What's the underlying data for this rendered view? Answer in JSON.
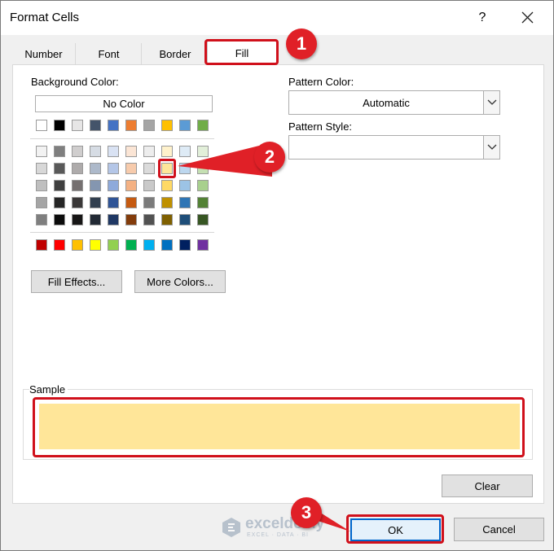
{
  "dialog": {
    "title": "Format Cells",
    "help_label": "?"
  },
  "tabs": [
    "Number",
    "Font",
    "Border",
    "Fill"
  ],
  "active_tab": "Fill",
  "fill": {
    "background_color_label": "Background Color:",
    "no_color_label": "No Color",
    "palette": {
      "theme_top_row": [
        "#ffffff",
        "#000000",
        "#e7e6e6",
        "#44546a",
        "#4472c4",
        "#ed7d31",
        "#a5a5a5",
        "#ffc000",
        "#5b9bd5",
        "#70ad47"
      ],
      "theme_shades": [
        [
          "#f2f2f2",
          "#7f7f7f",
          "#d0cece",
          "#d6dce4",
          "#d9e2f3",
          "#fbe5d5",
          "#ededed",
          "#fff2cc",
          "#deebf6",
          "#e2efd9"
        ],
        [
          "#d8d8d8",
          "#595959",
          "#aeabab",
          "#adb9ca",
          "#b4c6e7",
          "#f7cbac",
          "#dbdbdb",
          "#fee599",
          "#bdd7ee",
          "#c5e0b3"
        ],
        [
          "#bfbfbf",
          "#3f3f3f",
          "#757070",
          "#8496b0",
          "#8eaadb",
          "#f4b183",
          "#c9c9c9",
          "#ffd965",
          "#9cc3e5",
          "#a8d08d"
        ],
        [
          "#a5a5a5",
          "#262626",
          "#3a3838",
          "#323f4f",
          "#2f5496",
          "#c55a11",
          "#7b7b7b",
          "#bf9000",
          "#2e75b5",
          "#538135"
        ],
        [
          "#7f7f7f",
          "#0c0c0c",
          "#171616",
          "#222a35",
          "#1f3864",
          "#833c0b",
          "#525252",
          "#7f6000",
          "#1e4e79",
          "#375623"
        ]
      ],
      "standard_row": [
        "#c00000",
        "#ff0000",
        "#ffc000",
        "#ffff00",
        "#92d050",
        "#00b050",
        "#00b0f0",
        "#0070c0",
        "#002060",
        "#7030a0"
      ],
      "selected_color": "#fee599"
    },
    "fill_effects_label": "Fill Effects...",
    "more_colors_label": "More Colors...",
    "pattern_color_label": "Pattern Color:",
    "pattern_color_value": "Automatic",
    "pattern_style_label": "Pattern Style:",
    "pattern_style_value": "",
    "sample_label": "Sample",
    "sample_color": "#ffe699",
    "clear_label": "Clear"
  },
  "footer": {
    "ok_label": "OK",
    "cancel_label": "Cancel"
  },
  "annotations": {
    "step1": "1",
    "step2": "2",
    "step3": "3",
    "highlight_color": "#d0101b"
  },
  "watermark": {
    "name": "exceldemy",
    "tagline": "EXCEL · DATA · BI"
  }
}
